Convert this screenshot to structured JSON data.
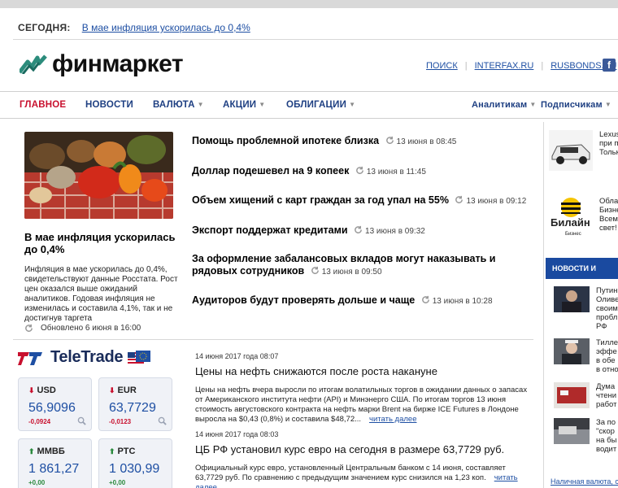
{
  "header": {
    "today_label": "СЕГОДНЯ:",
    "today_link": "В мае инфляция ускорилась до 0,4%",
    "logo_text": "финмаркет",
    "top_links": [
      "ПОИСК",
      "INTERFAX.RU",
      "RUSBONDS.RU"
    ],
    "facebook_icon": "f"
  },
  "nav": {
    "items": [
      {
        "label": "ГЛАВНОЕ",
        "active": true,
        "dropdown": false
      },
      {
        "label": "НОВОСТИ",
        "active": false,
        "dropdown": false
      },
      {
        "label": "ВАЛЮТА",
        "active": false,
        "dropdown": true
      },
      {
        "label": "АКЦИИ",
        "active": false,
        "dropdown": true
      },
      {
        "label": "ОБЛИГАЦИИ",
        "active": false,
        "dropdown": true
      }
    ],
    "right_items": [
      {
        "label": "Аналитикам",
        "dropdown": true
      },
      {
        "label": "Подписчикам",
        "dropdown": true
      }
    ]
  },
  "feature": {
    "title": "В мае инфляция ускорилась до 0,4%",
    "text": "Инфляция в мае ускорилась до 0,4%, свидетельствуют данные Росстата. Рост цен оказался выше ожиданий аналитиков. Годовая инфляция не изменилась и составила 4,1%, так и не достигнув таргета",
    "updated": "Обновлено 6 июня в 16:00"
  },
  "headlines": [
    {
      "title": "Помощь проблемной ипотеке близка",
      "time": "13 июня в 08:45"
    },
    {
      "title": "Доллар подешевел на 9 копеек",
      "time": "13 июня в 11:45"
    },
    {
      "title": "Объем хищений с карт граждан за год упал на 55%",
      "time": "13 июня в 09:12"
    },
    {
      "title": "Экспорт поддержат кредитами",
      "time": "13 июня в 09:32"
    },
    {
      "title": "За оформление забалансовых вкладов могут наказывать и рядовых сотрудников",
      "time": "13 июня в 09:50"
    },
    {
      "title": "Аудиторов будут проверять дольше и чаще",
      "time": "13 июня в 10:28"
    }
  ],
  "teletrade": {
    "brand": "TeleTrade",
    "quotes": [
      {
        "name": "USD",
        "direction": "down",
        "value": "56,9096",
        "change": "-0,0924"
      },
      {
        "name": "EUR",
        "direction": "down",
        "value": "63,7729",
        "change": "-0,0123"
      },
      {
        "name": "ММВБ",
        "direction": "up",
        "value": "1 861,27",
        "change": "+0,00"
      },
      {
        "name": "РТС",
        "direction": "up",
        "value": "1 030,99",
        "change": "+0,00"
      }
    ]
  },
  "articles": [
    {
      "date": "14 июня 2017 года 08:07",
      "title": "Цены на нефть снижаются после роста накануне",
      "body": "Цены на нефть вчера выросли по итогам волатильных торгов в ожидании данных о запасах от Американского института нефти (API) и Минэнерго США. По итогам торгов 13 июня стоимость августовского контракта на нефть марки Brent на бирже ICE Futures в Лондоне выросла на $0,43 (0,8%) и составила $48,72...",
      "more": "читать далее"
    },
    {
      "date": "14 июня 2017 года 08:03",
      "title": "ЦБ РФ установил курс евро на сегодня в размере 63,7729 руб.",
      "body": "Официальный курс евро, установленный Центральным банком с 14 июня, составляет 63,7729 руб. По сравнению с предыдущим значением курс снизился на 1,23 коп.",
      "more": "читать далее"
    }
  ],
  "right_column": {
    "ads": [
      {
        "text": [
          "Lexus",
          "при по",
          "Тольк"
        ]
      },
      {
        "logo_text": "Билайн",
        "logo_sub": "Бизнес",
        "text": [
          "Облач",
          "Бизне",
          "Всем з",
          "свет!"
        ]
      }
    ],
    "news_header": "НОВОСТИ И",
    "news": [
      {
        "text": [
          "Путин",
          "Оливе",
          "своим",
          "пробл",
          "РФ"
        ]
      },
      {
        "text": [
          "Тилле",
          "эффе",
          "в обе",
          "в отно"
        ]
      },
      {
        "text": [
          "Дума",
          "чтени",
          "работ"
        ]
      },
      {
        "text": [
          "За по",
          "\"скор",
          "на бы",
          "водит"
        ]
      }
    ],
    "bottom_link": "Наличная валюта, стран"
  }
}
